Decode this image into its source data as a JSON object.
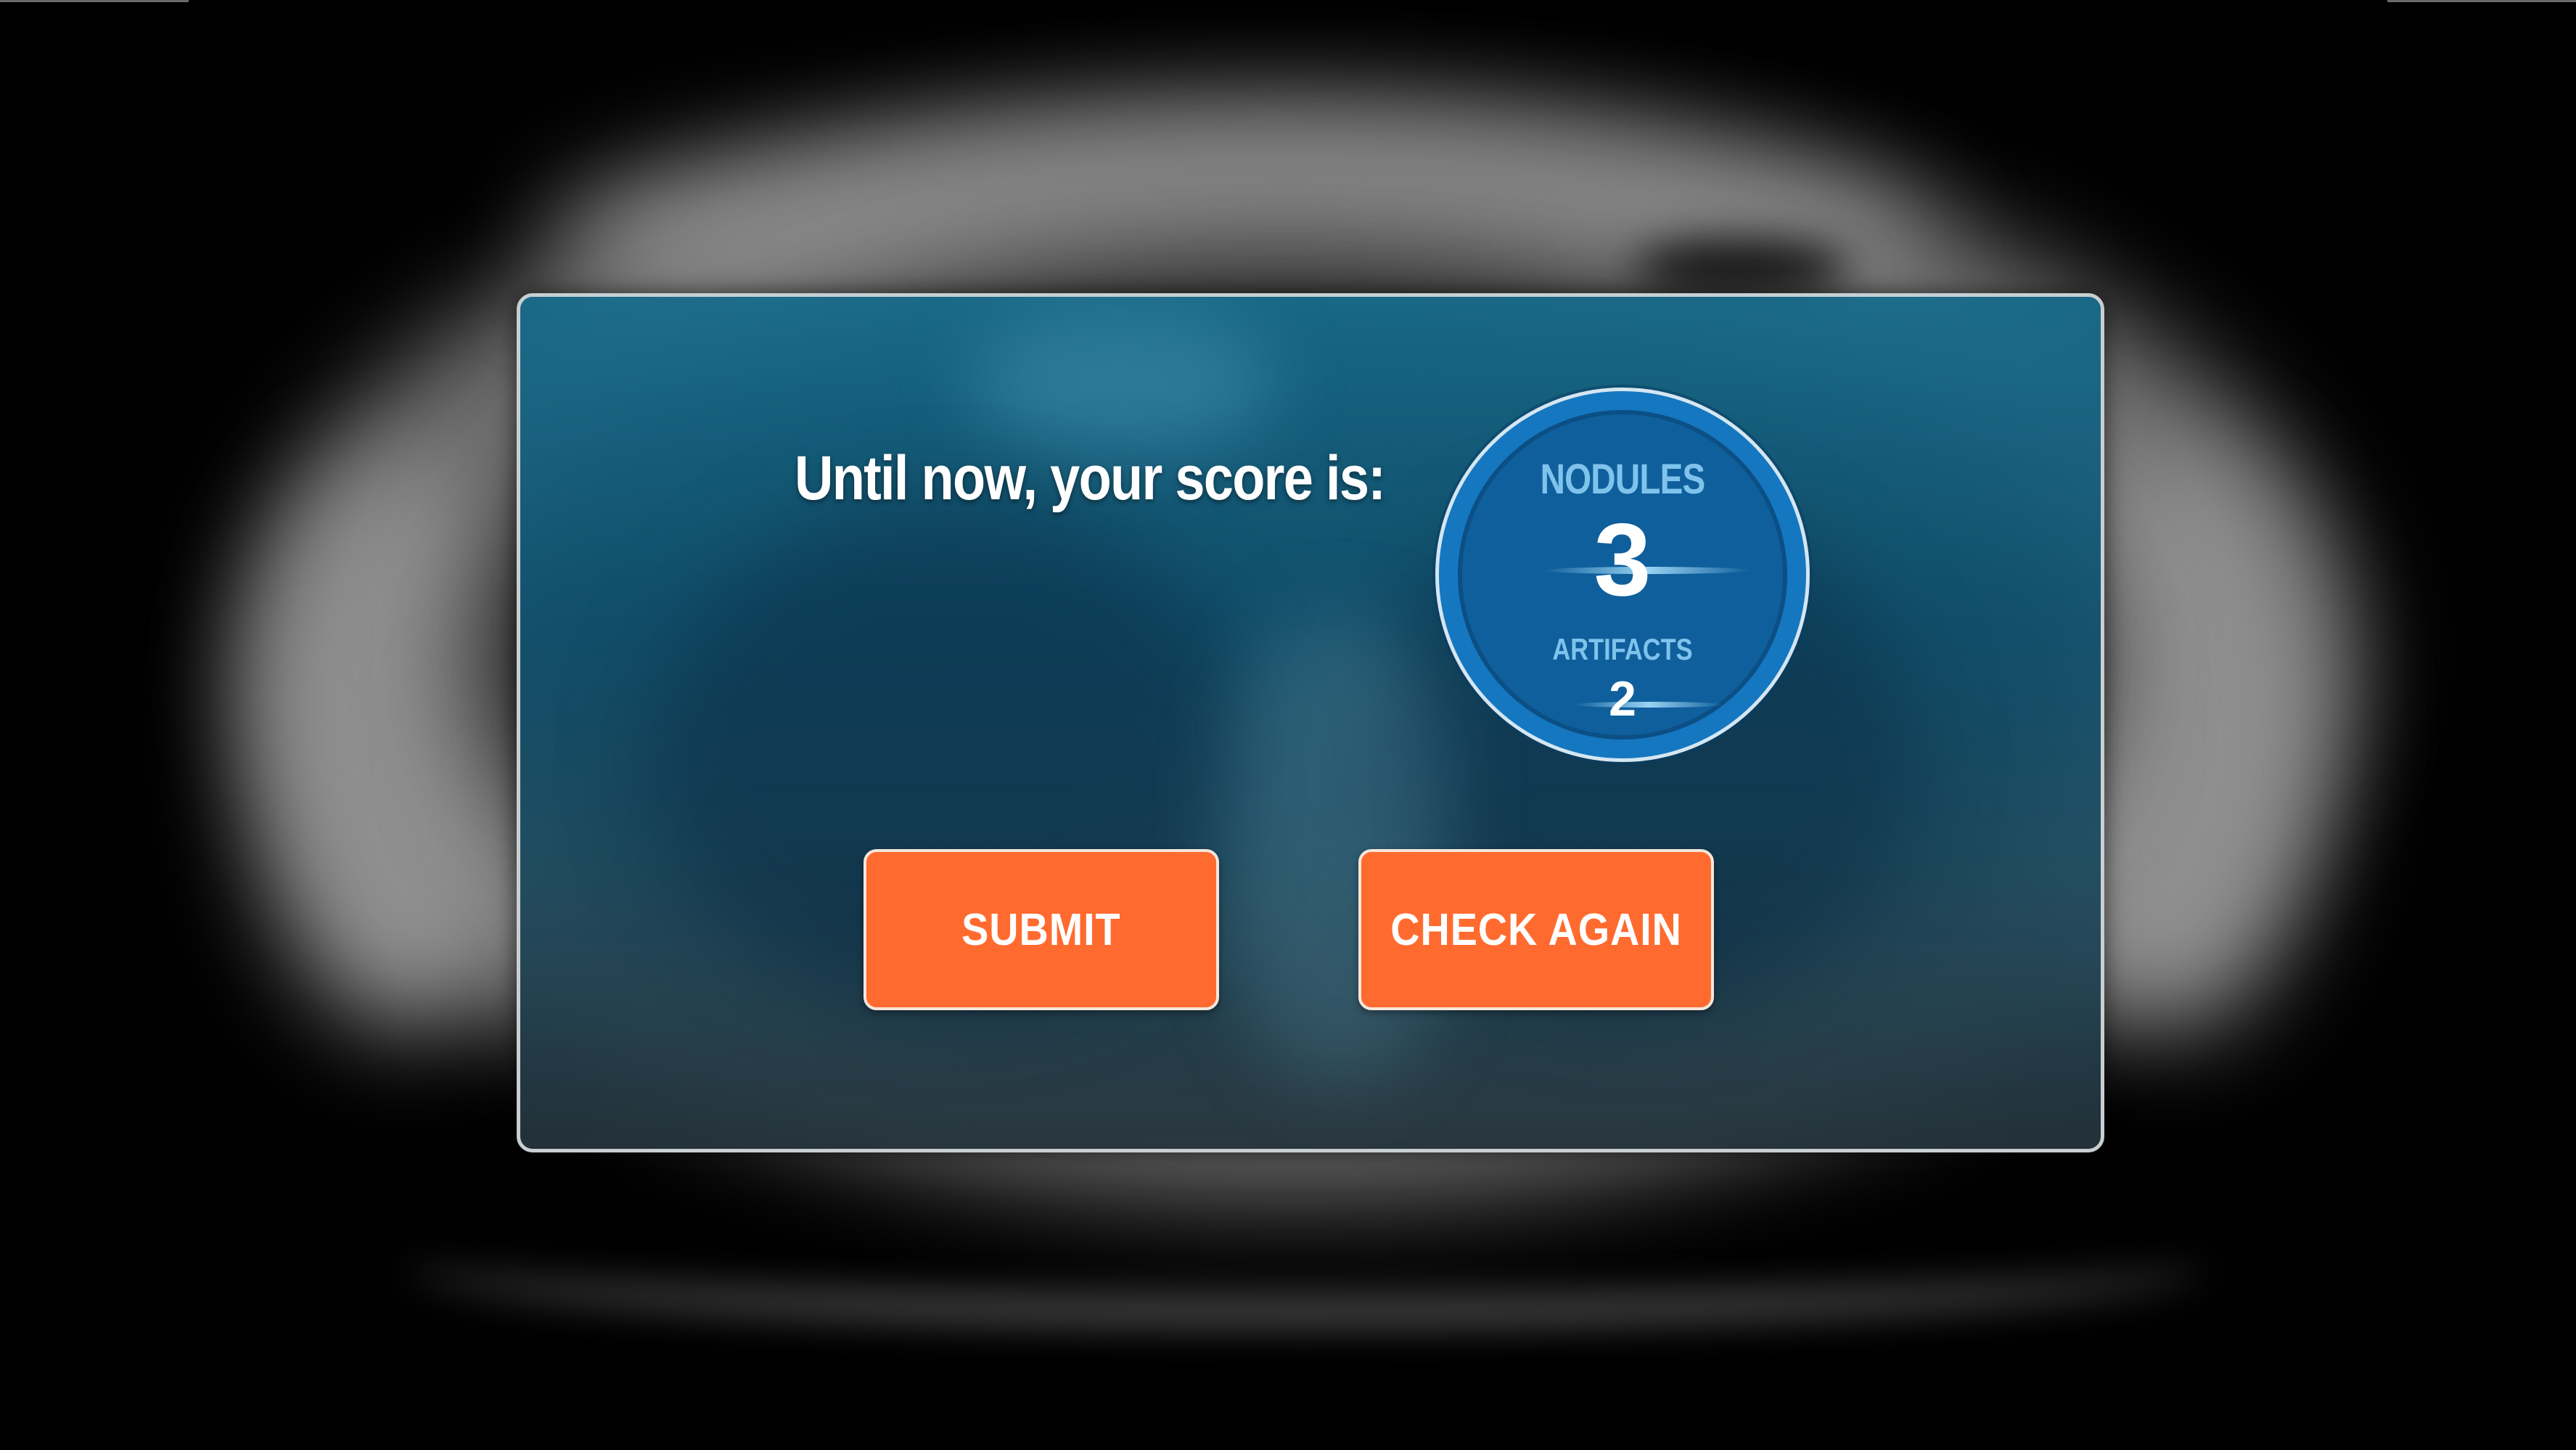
{
  "dialog": {
    "heading": "Until now, your score is:"
  },
  "score_badge": {
    "nodules_label": "NODULES",
    "nodules_value": "3",
    "artifacts_label": "ARTIFACTS",
    "artifacts_value": "2"
  },
  "buttons": {
    "submit_label": "SUBMIT",
    "check_again_label": "CHECK AGAIN"
  },
  "colors": {
    "button_fill": "#ff6b2f",
    "badge_blue": "#1577c0",
    "dialog_teal": "#166c8c",
    "label_light_blue": "#7fc3ec"
  }
}
